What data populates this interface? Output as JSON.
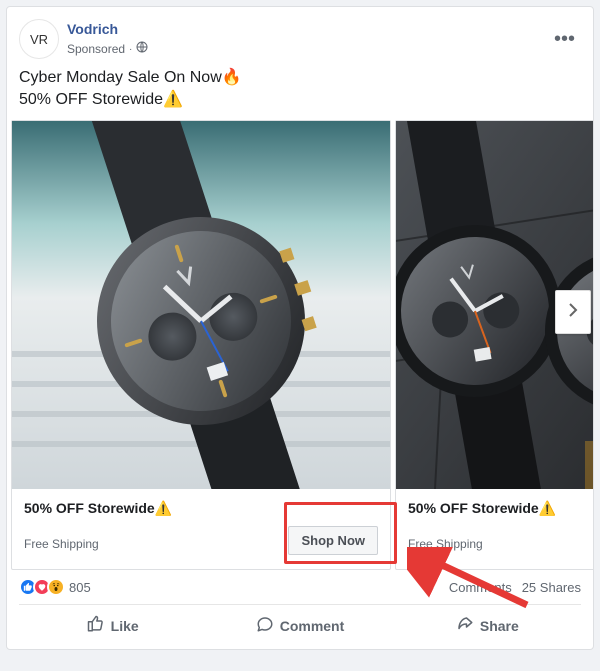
{
  "header": {
    "avatar_text": "VR",
    "page_name": "Vodrich",
    "sponsored_label": "Sponsored",
    "audience_icon": "globe-icon"
  },
  "post": {
    "line1": "Cyber Monday Sale On Now🔥",
    "line2": "50% OFF Storewide⚠️"
  },
  "carousel": {
    "cards": [
      {
        "title": "50% OFF Storewide⚠️",
        "subtitle": "Free Shipping",
        "cta": "Shop Now"
      },
      {
        "title": "50% OFF Storewide⚠️",
        "subtitle": "Free Shipping"
      }
    ]
  },
  "engagement": {
    "reaction_count": "805",
    "comments": "Comments",
    "shares_count": "25",
    "shares_label": "Shares"
  },
  "actions": {
    "like": "Like",
    "comment": "Comment",
    "share": "Share"
  }
}
